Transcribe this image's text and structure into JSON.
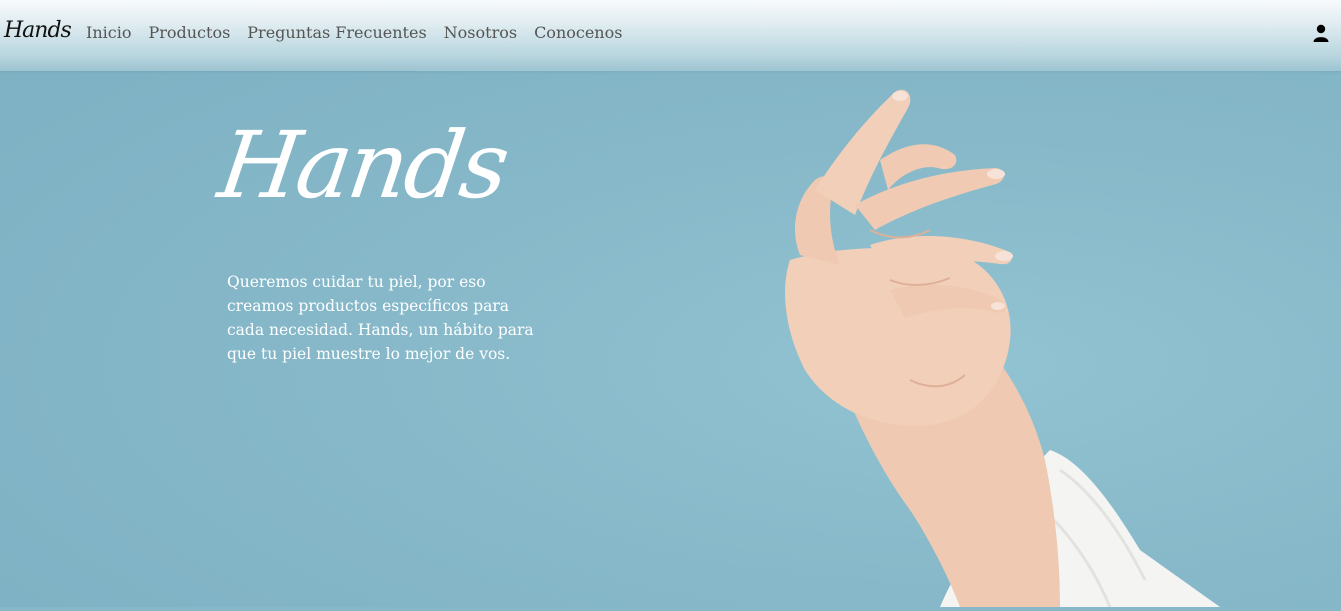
{
  "navbar": {
    "logo": "Hands",
    "links": [
      "Inicio",
      "Productos",
      "Preguntas Frecuentes",
      "Nosotros",
      "Conocenos"
    ],
    "user_icon": "user-icon"
  },
  "hero": {
    "title": "Hands",
    "description": "Queremos cuidar tu piel, por eso creamos productos específicos para cada necesidad. Hands, un hábito para que tu piel muestre lo mejor de vos.",
    "image": "hands-photo"
  },
  "colors": {
    "background": "#86b8c9",
    "nav_text": "#555555",
    "hero_text": "#ffffff",
    "skin": "#f0cdb6",
    "sweater": "#f4f4f2"
  }
}
